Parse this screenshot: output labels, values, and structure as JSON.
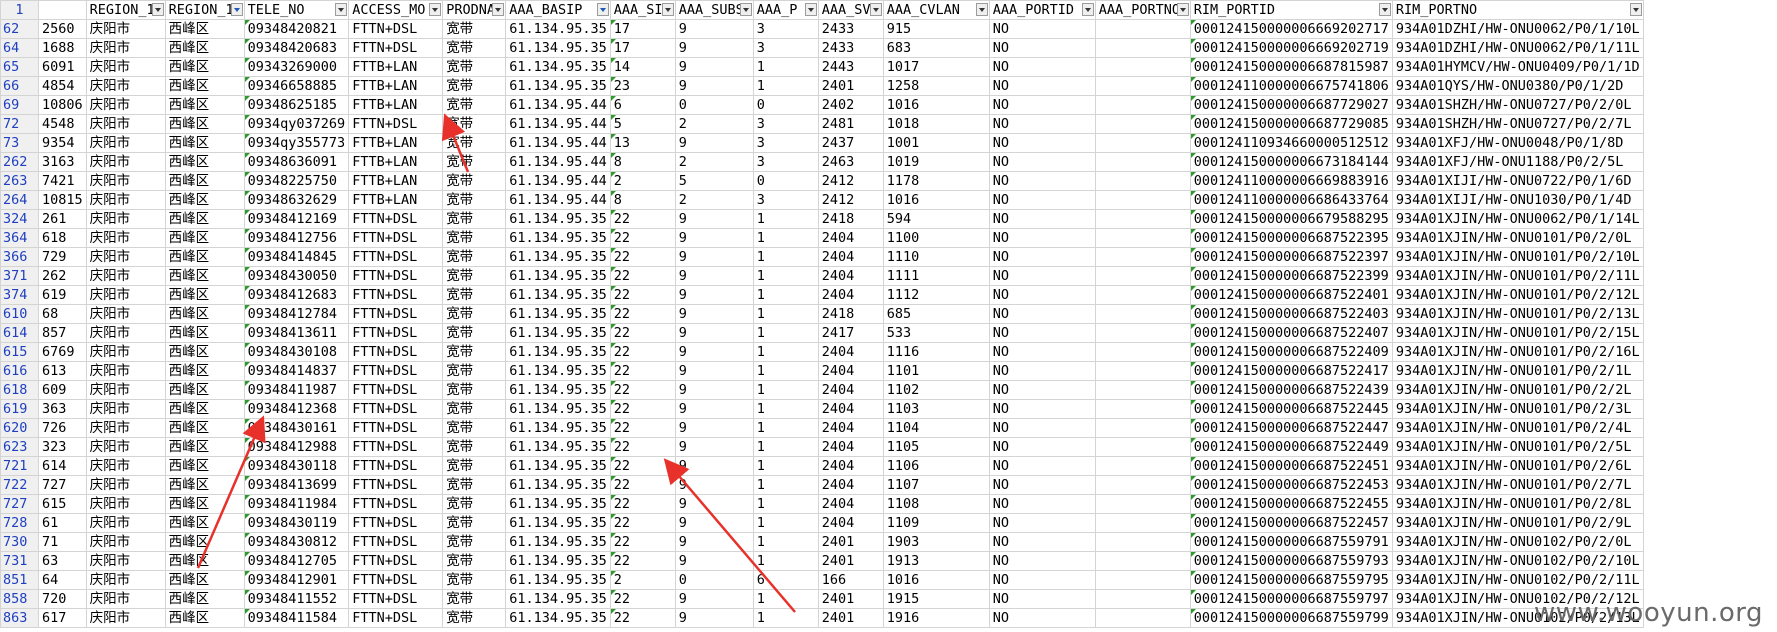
{
  "header_row_number": "1",
  "columns": [
    "REGION_1",
    "REGION_1",
    "TELE_NO",
    "ACCESS_MO",
    "PRODNA",
    "AAA_BASIP",
    "AAA_SI",
    "AAA_SUBS",
    "AAA_P",
    "AAA_SV",
    "AAA_CVLAN",
    "AAA_PORTID",
    "AAA_PORTNO",
    "RIM_PORTID",
    "RIM_PORTNO"
  ],
  "rows": [
    [
      "62",
      "2560",
      "庆阳市",
      "西峰区",
      "09348420821",
      "FTTN+DSL",
      "宽带",
      "61.134.95.35",
      "17",
      "9",
      "3",
      "2433",
      "915",
      "NO",
      "",
      "000124150000006669202717",
      "934A01DZHI/HW-ONU0062/P0/1/10L"
    ],
    [
      "64",
      "1688",
      "庆阳市",
      "西峰区",
      "09348420683",
      "FTTN+DSL",
      "宽带",
      "61.134.95.35",
      "17",
      "9",
      "3",
      "2433",
      "683",
      "NO",
      "",
      "000124150000006669202719",
      "934A01DZHI/HW-ONU0062/P0/1/11L"
    ],
    [
      "65",
      "6091",
      "庆阳市",
      "西峰区",
      "09343269000",
      "FTTB+LAN",
      "宽带",
      "61.134.95.35",
      "14",
      "9",
      "1",
      "2443",
      "1017",
      "NO",
      "",
      "000124150000006687815987",
      "934A01HYMCV/HW-ONU0409/P0/1/1D"
    ],
    [
      "66",
      "4854",
      "庆阳市",
      "西峰区",
      "09346658885",
      "FTTB+LAN",
      "宽带",
      "61.134.95.35",
      "23",
      "9",
      "1",
      "2401",
      "1258",
      "NO",
      "",
      "000124110000006675741806",
      "934A01QYS/HW-ONU0380/P0/1/2D"
    ],
    [
      "69",
      "10806",
      "庆阳市",
      "西峰区",
      "09348625185",
      "FTTB+LAN",
      "宽带",
      "61.134.95.44",
      "6",
      "0",
      "0",
      "2402",
      "1016",
      "NO",
      "",
      "000124150000006687729027",
      "934A01SHZH/HW-ONU0727/P0/2/0L"
    ],
    [
      "72",
      "4548",
      "庆阳市",
      "西峰区",
      "0934qy037269",
      "FTTN+DSL",
      "宽带",
      "61.134.95.44",
      "5",
      "2",
      "3",
      "2481",
      "1018",
      "NO",
      "",
      "000124150000006687729085",
      "934A01SHZH/HW-ONU0727/P0/2/7L"
    ],
    [
      "73",
      "9354",
      "庆阳市",
      "西峰区",
      "0934qy355773",
      "FTTB+LAN",
      "宽带",
      "61.134.95.44",
      "13",
      "9",
      "3",
      "2437",
      "1001",
      "NO",
      "",
      "000124110934660000512512",
      "934A01XFJ/HW-ONU0048/P0/1/8D"
    ],
    [
      "262",
      "3163",
      "庆阳市",
      "西峰区",
      "09348636091",
      "FTTB+LAN",
      "宽带",
      "61.134.95.44",
      "8",
      "2",
      "3",
      "2463",
      "1019",
      "NO",
      "",
      "000124150000006673184144",
      "934A01XFJ/HW-ONU1188/P0/2/5L"
    ],
    [
      "263",
      "7421",
      "庆阳市",
      "西峰区",
      "09348225750",
      "FTTB+LAN",
      "宽带",
      "61.134.95.44",
      "2",
      "5",
      "0",
      "2412",
      "1178",
      "NO",
      "",
      "000124110000006669883916",
      "934A01XIJI/HW-ONU0722/P0/1/6D"
    ],
    [
      "264",
      "10815",
      "庆阳市",
      "西峰区",
      "09348632629",
      "FTTB+LAN",
      "宽带",
      "61.134.95.44",
      "8",
      "2",
      "3",
      "2412",
      "1016",
      "NO",
      "",
      "000124110000006686433764",
      "934A01XIJI/HW-ONU1030/P0/1/4D"
    ],
    [
      "324",
      "261",
      "庆阳市",
      "西峰区",
      "09348412169",
      "FTTN+DSL",
      "宽带",
      "61.134.95.35",
      "22",
      "9",
      "1",
      "2418",
      "594",
      "NO",
      "",
      "000124150000006679588295",
      "934A01XJIN/HW-ONU0062/P0/1/14L"
    ],
    [
      "364",
      "618",
      "庆阳市",
      "西峰区",
      "09348412756",
      "FTTN+DSL",
      "宽带",
      "61.134.95.35",
      "22",
      "9",
      "1",
      "2404",
      "1100",
      "NO",
      "",
      "000124150000006687522395",
      "934A01XJIN/HW-ONU0101/P0/2/0L"
    ],
    [
      "366",
      "729",
      "庆阳市",
      "西峰区",
      "09348414845",
      "FTTN+DSL",
      "宽带",
      "61.134.95.35",
      "22",
      "9",
      "1",
      "2404",
      "1110",
      "NO",
      "",
      "000124150000006687522397",
      "934A01XJIN/HW-ONU0101/P0/2/10L"
    ],
    [
      "371",
      "262",
      "庆阳市",
      "西峰区",
      "09348430050",
      "FTTN+DSL",
      "宽带",
      "61.134.95.35",
      "22",
      "9",
      "1",
      "2404",
      "1111",
      "NO",
      "",
      "000124150000006687522399",
      "934A01XJIN/HW-ONU0101/P0/2/11L"
    ],
    [
      "374",
      "619",
      "庆阳市",
      "西峰区",
      "09348412683",
      "FTTN+DSL",
      "宽带",
      "61.134.95.35",
      "22",
      "9",
      "1",
      "2404",
      "1112",
      "NO",
      "",
      "000124150000006687522401",
      "934A01XJIN/HW-ONU0101/P0/2/12L"
    ],
    [
      "610",
      "68",
      "庆阳市",
      "西峰区",
      "09348412784",
      "FTTN+DSL",
      "宽带",
      "61.134.95.35",
      "22",
      "9",
      "1",
      "2418",
      "685",
      "NO",
      "",
      "000124150000006687522403",
      "934A01XJIN/HW-ONU0101/P0/2/13L"
    ],
    [
      "614",
      "857",
      "庆阳市",
      "西峰区",
      "09348413611",
      "FTTN+DSL",
      "宽带",
      "61.134.95.35",
      "22",
      "9",
      "1",
      "2417",
      "533",
      "NO",
      "",
      "000124150000006687522407",
      "934A01XJIN/HW-ONU0101/P0/2/15L"
    ],
    [
      "615",
      "6769",
      "庆阳市",
      "西峰区",
      "09348430108",
      "FTTN+DSL",
      "宽带",
      "61.134.95.35",
      "22",
      "9",
      "1",
      "2404",
      "1116",
      "NO",
      "",
      "000124150000006687522409",
      "934A01XJIN/HW-ONU0101/P0/2/16L"
    ],
    [
      "616",
      "613",
      "庆阳市",
      "西峰区",
      "09348414837",
      "FTTN+DSL",
      "宽带",
      "61.134.95.35",
      "22",
      "9",
      "1",
      "2404",
      "1101",
      "NO",
      "",
      "000124150000006687522417",
      "934A01XJIN/HW-ONU0101/P0/2/1L"
    ],
    [
      "618",
      "609",
      "庆阳市",
      "西峰区",
      "09348411987",
      "FTTN+DSL",
      "宽带",
      "61.134.95.35",
      "22",
      "9",
      "1",
      "2404",
      "1102",
      "NO",
      "",
      "000124150000006687522439",
      "934A01XJIN/HW-ONU0101/P0/2/2L"
    ],
    [
      "619",
      "363",
      "庆阳市",
      "西峰区",
      "09348412368",
      "FTTN+DSL",
      "宽带",
      "61.134.95.35",
      "22",
      "9",
      "1",
      "2404",
      "1103",
      "NO",
      "",
      "000124150000006687522445",
      "934A01XJIN/HW-ONU0101/P0/2/3L"
    ],
    [
      "620",
      "726",
      "庆阳市",
      "西峰区",
      "09348430161",
      "FTTN+DSL",
      "宽带",
      "61.134.95.35",
      "22",
      "9",
      "1",
      "2404",
      "1104",
      "NO",
      "",
      "000124150000006687522447",
      "934A01XJIN/HW-ONU0101/P0/2/4L"
    ],
    [
      "623",
      "323",
      "庆阳市",
      "西峰区",
      "09348412988",
      "FTTN+DSL",
      "宽带",
      "61.134.95.35",
      "22",
      "9",
      "1",
      "2404",
      "1105",
      "NO",
      "",
      "000124150000006687522449",
      "934A01XJIN/HW-ONU0101/P0/2/5L"
    ],
    [
      "721",
      "614",
      "庆阳市",
      "西峰区",
      "09348430118",
      "FTTN+DSL",
      "宽带",
      "61.134.95.35",
      "22",
      "9",
      "1",
      "2404",
      "1106",
      "NO",
      "",
      "000124150000006687522451",
      "934A01XJIN/HW-ONU0101/P0/2/6L"
    ],
    [
      "722",
      "727",
      "庆阳市",
      "西峰区",
      "09348413699",
      "FTTN+DSL",
      "宽带",
      "61.134.95.35",
      "22",
      "9",
      "1",
      "2404",
      "1107",
      "NO",
      "",
      "000124150000006687522453",
      "934A01XJIN/HW-ONU0101/P0/2/7L"
    ],
    [
      "727",
      "615",
      "庆阳市",
      "西峰区",
      "09348411984",
      "FTTN+DSL",
      "宽带",
      "61.134.95.35",
      "22",
      "9",
      "1",
      "2404",
      "1108",
      "NO",
      "",
      "000124150000006687522455",
      "934A01XJIN/HW-ONU0101/P0/2/8L"
    ],
    [
      "728",
      "61",
      "庆阳市",
      "西峰区",
      "09348430119",
      "FTTN+DSL",
      "宽带",
      "61.134.95.35",
      "22",
      "9",
      "1",
      "2404",
      "1109",
      "NO",
      "",
      "000124150000006687522457",
      "934A01XJIN/HW-ONU0101/P0/2/9L"
    ],
    [
      "730",
      "71",
      "庆阳市",
      "西峰区",
      "09348430812",
      "FTTN+DSL",
      "宽带",
      "61.134.95.35",
      "22",
      "9",
      "1",
      "2401",
      "1903",
      "NO",
      "",
      "000124150000006687559791",
      "934A01XJIN/HW-ONU0102/P0/2/0L"
    ],
    [
      "731",
      "63",
      "庆阳市",
      "西峰区",
      "09348412705",
      "FTTN+DSL",
      "宽带",
      "61.134.95.35",
      "22",
      "9",
      "1",
      "2401",
      "1913",
      "NO",
      "",
      "000124150000006687559793",
      "934A01XJIN/HW-ONU0102/P0/2/10L"
    ],
    [
      "851",
      "64",
      "庆阳市",
      "西峰区",
      "09348412901",
      "FTTN+DSL",
      "宽带",
      "61.134.95.35",
      "2",
      "0",
      "6",
      "166",
      "1016",
      "NO",
      "",
      "000124150000006687559795",
      "934A01XJIN/HW-ONU0102/P0/2/11L"
    ],
    [
      "858",
      "720",
      "庆阳市",
      "西峰区",
      "09348411552",
      "FTTN+DSL",
      "宽带",
      "61.134.95.35",
      "22",
      "9",
      "1",
      "2401",
      "1915",
      "NO",
      "",
      "000124150000006687559797",
      "934A01XJIN/HW-ONU0102/P0/2/12L"
    ],
    [
      "863",
      "617",
      "庆阳市",
      "西峰区",
      "09348411584",
      "FTTN+DSL",
      "宽带",
      "61.134.95.35",
      "22",
      "9",
      "1",
      "2401",
      "1916",
      "NO",
      "",
      "000124150000006687559799",
      "934A01XJIN/HW-ONU0102/P0/2/13L"
    ]
  ],
  "watermark": "www.wooyun.org",
  "colors": {
    "row_number_text": "#1f3fbf",
    "grid": "#d4d4d4",
    "arrow": "#e8312a",
    "error_indicator": "#2e9a2e"
  }
}
